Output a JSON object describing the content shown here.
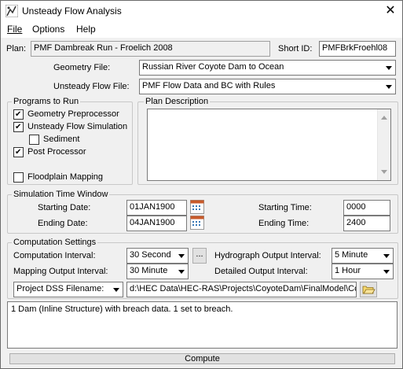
{
  "window": {
    "title": "Unsteady Flow Analysis",
    "close": "✕"
  },
  "menu": {
    "file": "File",
    "options": "Options",
    "help": "Help"
  },
  "plan": {
    "label": "Plan:",
    "value": "PMF Dambreak Run - Froelich 2008",
    "short_id_label": "Short ID:",
    "short_id": "PMFBrkFroehl08"
  },
  "geometry": {
    "label": "Geometry File:",
    "value": "Russian River Coyote Dam to Ocean"
  },
  "unsteady": {
    "label": "Unsteady Flow File:",
    "value": "PMF Flow Data and BC with Rules"
  },
  "programs": {
    "legend": "Programs to Run",
    "items": [
      {
        "label": "Geometry Preprocessor",
        "checked": true
      },
      {
        "label": "Unsteady Flow Simulation",
        "checked": true
      },
      {
        "label": "Sediment",
        "checked": false
      },
      {
        "label": "Post Processor",
        "checked": true
      },
      {
        "label": "Floodplain Mapping",
        "checked": false
      }
    ]
  },
  "plan_description": {
    "legend": "Plan Description"
  },
  "sim_window": {
    "legend": "Simulation Time Window",
    "starting_date_label": "Starting Date:",
    "starting_date": "01JAN1900",
    "ending_date_label": "Ending Date:",
    "ending_date": "04JAN1900",
    "starting_time_label": "Starting Time:",
    "starting_time": "0000",
    "ending_time_label": "Ending Time:",
    "ending_time": "2400"
  },
  "computation": {
    "legend": "Computation Settings",
    "interval_label": "Computation Interval:",
    "interval": "30 Second",
    "ellipsis": "...",
    "hydrograph_label": "Hydrograph Output Interval:",
    "hydrograph": "5 Minute",
    "mapping_label": "Mapping Output Interval:",
    "mapping": "30 Minute",
    "detailed_label": "Detailed Output Interval:",
    "detailed": "1 Hour",
    "dss_label": "Project DSS Filename:",
    "dss_path": "d:\\HEC Data\\HEC-RAS\\Projects\\CoyoteDam\\FinalModel\\Coy"
  },
  "messages": {
    "text": "1 Dam (Inline Structure) with breach data.  1 set to breach."
  },
  "compute_button": "Compute",
  "colors": {
    "accent": "#0078d7",
    "field_border": "#7a7a7a"
  }
}
